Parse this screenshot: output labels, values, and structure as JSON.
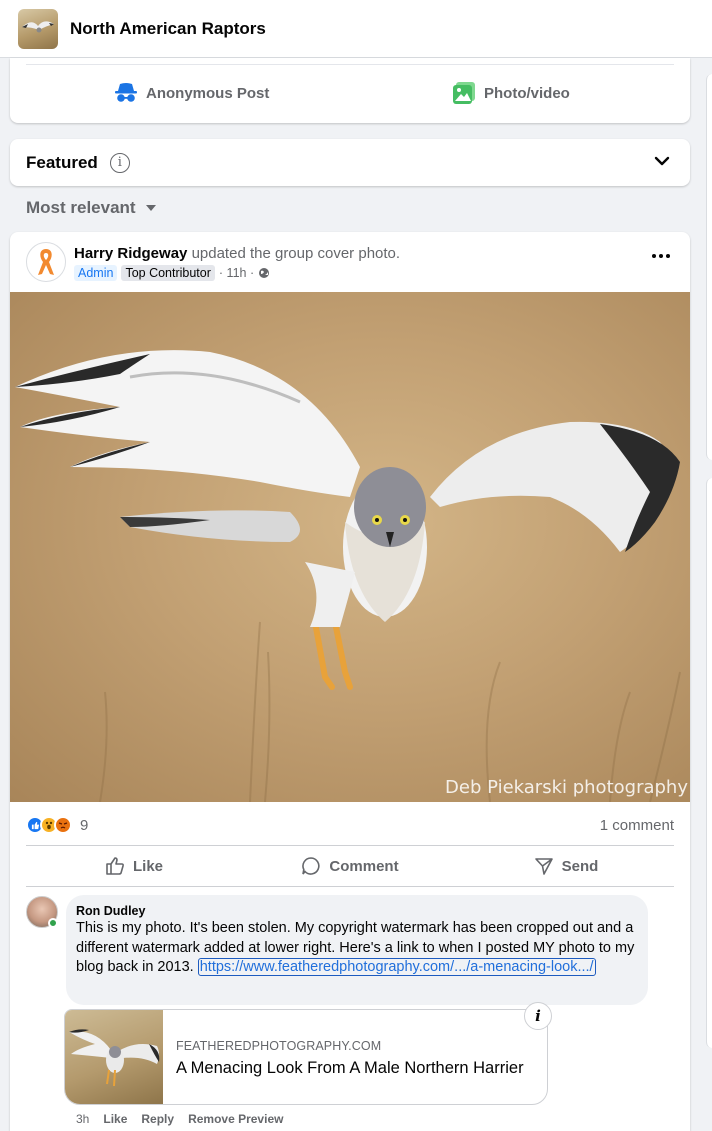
{
  "header": {
    "group_name": "North American Raptors"
  },
  "composer": {
    "anonymous_label": "Anonymous Post",
    "photo_label": "Photo/video"
  },
  "featured": {
    "label": "Featured",
    "info_icon": "i"
  },
  "sort": {
    "label": "Most relevant"
  },
  "post": {
    "author": "Harry Ridgeway",
    "action": "updated the group cover photo.",
    "badge_admin": "Admin",
    "badge_top": "Top Contributor",
    "time": "· 11h ·",
    "watermark": "Deb Piekarski photography",
    "reaction_count": "9",
    "comment_count": "1 comment",
    "actions": {
      "like": "Like",
      "comment": "Comment",
      "send": "Send"
    }
  },
  "comment": {
    "author": "Ron Dudley",
    "text": "This is my photo. It's been stolen. My copyright watermark has been cropped out and a different watermark added at lower right. Here's a link to when I posted MY photo to my blog back in 2013.",
    "link": "https://www.featheredphotography.com/.../a-menacing-look.../",
    "preview_domain": "FEATHEREDPHOTOGRAPHY.COM",
    "preview_title": "A Menacing Look From A Male Northern Harrier",
    "preview_info": "i",
    "meta": {
      "time": "3h",
      "like": "Like",
      "reply": "Reply",
      "remove_preview": "Remove Preview"
    }
  },
  "colors": {
    "accent": "#1877f2",
    "muted": "#65676b",
    "background": "#f0f2f5"
  }
}
